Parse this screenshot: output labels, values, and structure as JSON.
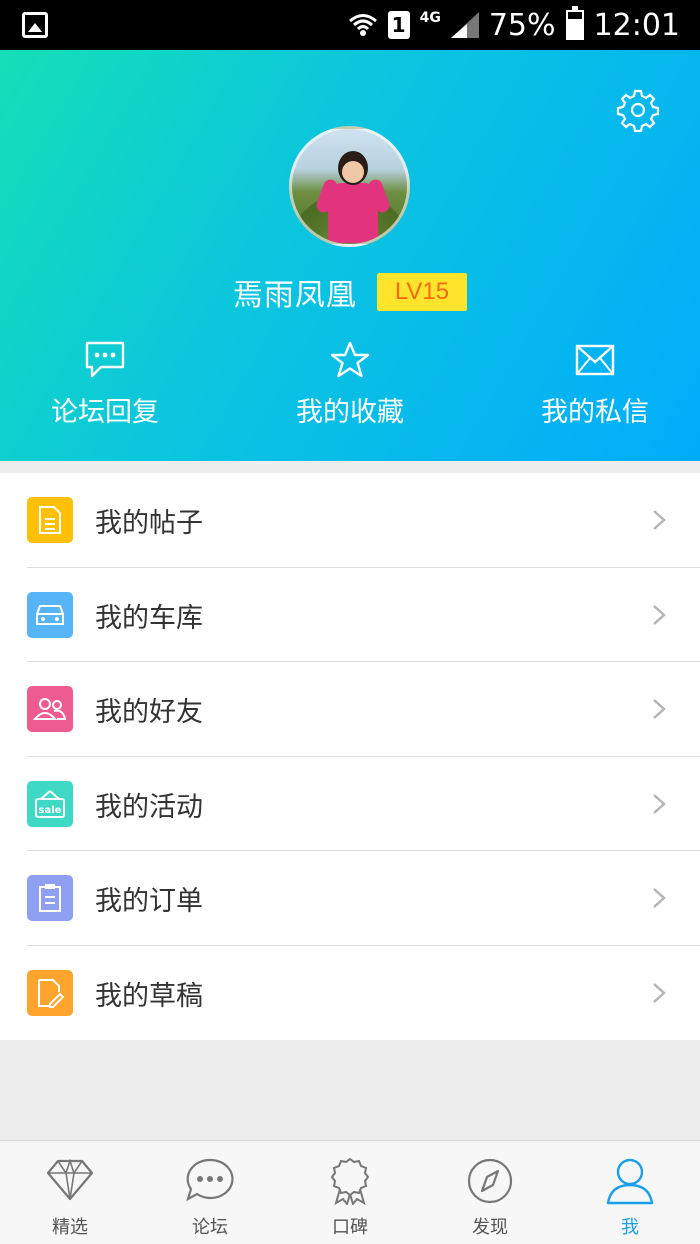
{
  "status_bar": {
    "signal": "4G",
    "sim": "1",
    "battery": "75%",
    "battery_level": 0.75,
    "time": "12:01"
  },
  "profile": {
    "username": "焉雨凤凰",
    "level": "LV15",
    "settings_icon": "gear-icon"
  },
  "quick_actions": [
    {
      "label": "论坛回复",
      "icon": "chat-bubble-icon"
    },
    {
      "label": "我的收藏",
      "icon": "star-icon"
    },
    {
      "label": "我的私信",
      "icon": "envelope-icon"
    }
  ],
  "menu": [
    {
      "label": "我的帖子",
      "icon": "document-icon",
      "color": "#ffc107"
    },
    {
      "label": "我的车库",
      "icon": "car-icon",
      "color": "#57b4f6"
    },
    {
      "label": "我的好友",
      "icon": "friends-icon",
      "color": "#ee5b91"
    },
    {
      "label": "我的活动",
      "icon": "sale-tag-icon",
      "sale_text": "sale",
      "color": "#3ed9c4"
    },
    {
      "label": "我的订单",
      "icon": "clipboard-icon",
      "color": "#8fa0f3"
    },
    {
      "label": "我的草稿",
      "icon": "draft-icon",
      "color": "#ffa52d"
    }
  ],
  "tabs": [
    {
      "label": "精选",
      "icon": "diamond-icon",
      "active": false
    },
    {
      "label": "论坛",
      "icon": "chat-bubble-icon",
      "active": false
    },
    {
      "label": "口碑",
      "icon": "award-ribbon-icon",
      "active": false
    },
    {
      "label": "发现",
      "icon": "compass-icon",
      "active": false
    },
    {
      "label": "我",
      "icon": "person-icon",
      "active": true
    }
  ],
  "colors": {
    "header_start": "#15dfb7",
    "header_end": "#01acfb",
    "level_bg": "#ffe42b",
    "level_text": "#f36c12",
    "tab_active": "#1aa0ea"
  }
}
